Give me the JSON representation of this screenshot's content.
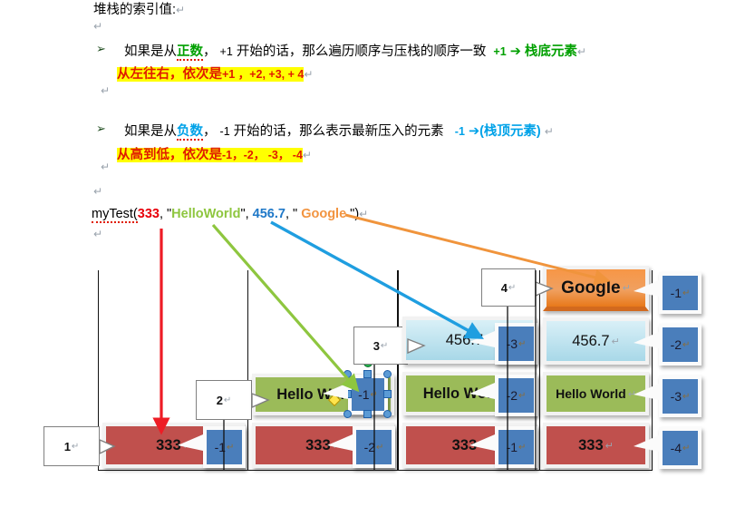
{
  "document": {
    "heading": "堆栈的索引值:",
    "bullets": [
      {
        "marker": "➢",
        "line1_a": "如果是从",
        "line1_kw": "正数",
        "line1_b": "， ",
        "line1_num": "+1",
        "line1_c": " 开始的话，那么遍历顺序与压栈的顺序一致",
        "line1_idx": "+1",
        "line1_arrow": "➔",
        "line1_tail": "栈底元素",
        "line2_a": "从左往右，依次是",
        "line2_b": "+1    ，+2,    +3,    + 4"
      },
      {
        "marker": "➢",
        "line1_a": "如果是从",
        "line1_kw": "负数",
        "line1_b": "， ",
        "line1_num": "-1",
        "line1_c": " 开始的话，那么表示最新压入的元素",
        "line1_idx": "-1",
        "line1_arrow": "➔",
        "line1_tail": "(栈顶元素)",
        "line2_a": "从高到低，依次是",
        "line2_b": "-1，-2，  -3，  -4"
      }
    ],
    "code": {
      "fn": "myTest(",
      "arg1": "333",
      "sep1": ", ",
      "q1": "\"",
      "arg2": "HelloWorld",
      "q2": "\"",
      "sep2": ", ",
      "arg3": "456.7",
      "sep3": ", ",
      "q3": "\"",
      "arg4": " Google ",
      "q4": "\"",
      "close": ")"
    },
    "pilcrow": "↵"
  },
  "arrows": [
    {
      "name": "arrow-to-333",
      "color": "#ee1c25",
      "label": "333"
    },
    {
      "name": "arrow-to-helloworld",
      "color": "#8ec63f",
      "label": "HelloWorld"
    },
    {
      "name": "arrow-to-456",
      "color": "#1f9ee0",
      "label": "456.7"
    },
    {
      "name": "arrow-to-google",
      "color": "#f0943c",
      "label": "Google"
    }
  ],
  "stacks": [
    {
      "step": "1",
      "items": [
        {
          "value": "333",
          "index": "-1",
          "color": "red"
        }
      ]
    },
    {
      "step": "2",
      "items": [
        {
          "value": "Hello World",
          "index": "-1",
          "color": "green",
          "selected": true
        },
        {
          "value": "333",
          "index": "-2",
          "color": "red"
        }
      ]
    },
    {
      "step": "3",
      "items": [
        {
          "value": "456.7",
          "index": "-3",
          "color": "cyan"
        },
        {
          "value": "Hello World",
          "index": "-2",
          "color": "green"
        },
        {
          "value": "333",
          "index": "-1",
          "color": "red"
        }
      ]
    },
    {
      "step": "4",
      "items": [
        {
          "value": "Google",
          "index": "-1",
          "color": "orange"
        },
        {
          "value": "456.7",
          "index": "-2",
          "color": "cyan"
        },
        {
          "value": "Hello World",
          "index": "-3",
          "color": "green"
        },
        {
          "value": "333",
          "index": "-4",
          "color": "red"
        }
      ]
    }
  ],
  "palette": {
    "red": "#c0504d",
    "green": "#9bbb59",
    "cyan": "#a8d8e8",
    "orange": "#f79646",
    "index_blue": "#4a7ebb",
    "highlight": "#ffff00"
  }
}
